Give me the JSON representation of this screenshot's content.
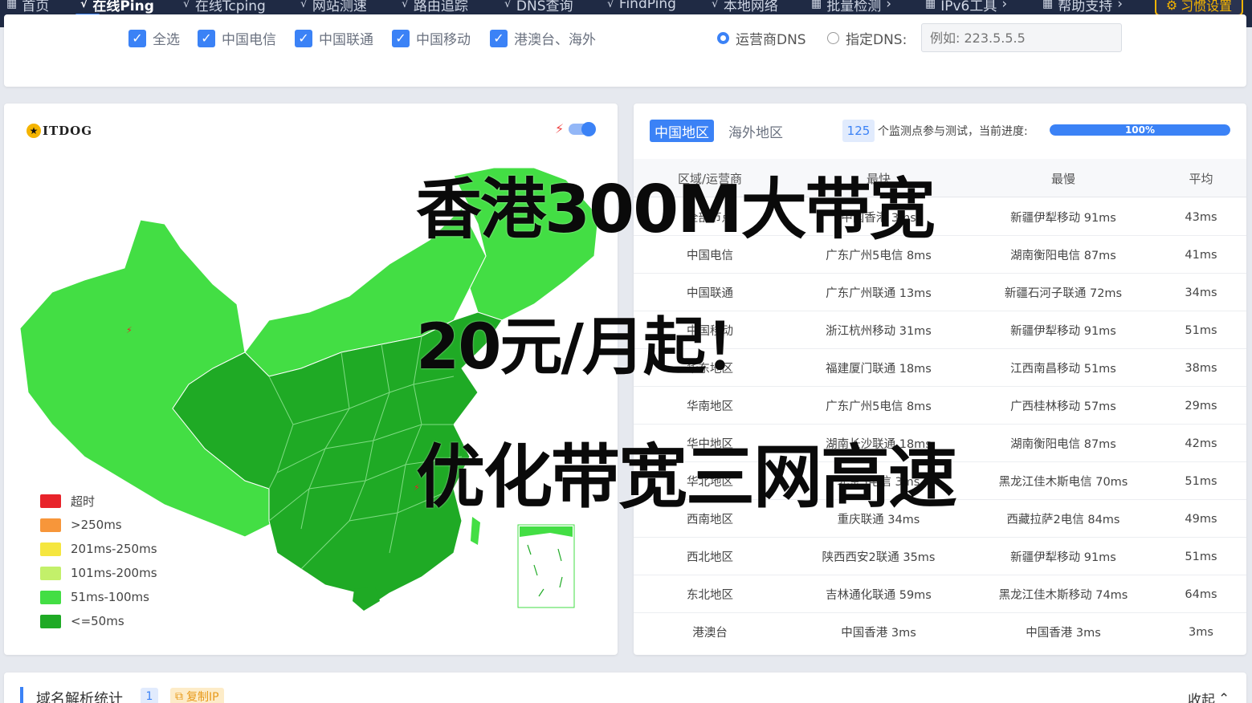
{
  "nav": {
    "items": [
      {
        "label": "首页",
        "icon": "grid-icon"
      },
      {
        "label": "在线Ping",
        "icon": "pulse-icon",
        "active": true
      },
      {
        "label": "在线Tcping",
        "icon": "pulse-icon"
      },
      {
        "label": "网站测速",
        "icon": "pulse-icon"
      },
      {
        "label": "路由追踪",
        "icon": "pulse-icon"
      },
      {
        "label": "DNS查询",
        "icon": "pulse-icon"
      },
      {
        "label": "FindPing",
        "icon": "pulse-icon"
      },
      {
        "label": "本地网络",
        "icon": "pulse-icon"
      },
      {
        "label": "批量检测",
        "icon": "grid-icon"
      },
      {
        "label": "IPv6工具",
        "icon": "grid-icon"
      },
      {
        "label": "帮助支持",
        "icon": "grid-icon"
      }
    ],
    "settings_label": "习惯设置"
  },
  "filters": {
    "checkboxes": [
      "全选",
      "中国电信",
      "中国联通",
      "中国移动",
      "港澳台、海外"
    ],
    "dns_options": [
      "运营商DNS",
      "指定DNS:"
    ],
    "dns_placeholder": "例如: 223.5.5.5"
  },
  "map": {
    "logo_text": "ITDOG",
    "legend": [
      {
        "label": "超时",
        "color": "#e8232a"
      },
      {
        "label": ">250ms",
        "color": "#f7963a"
      },
      {
        "label": "201ms-250ms",
        "color": "#f5e63f"
      },
      {
        "label": "101ms-200ms",
        "color": "#c3f06a"
      },
      {
        "label": "51ms-100ms",
        "color": "#43de44"
      },
      {
        "label": "<=50ms",
        "color": "#1faa25"
      }
    ]
  },
  "results": {
    "tabs": [
      "中国地区",
      "海外地区"
    ],
    "node_count": "125",
    "progress_label": "个监测点参与测试，当前进度:",
    "progress_value": "100%",
    "progress_fraction": 1.0,
    "headers": [
      "区域/运营商",
      "最快",
      "最慢",
      "平均"
    ],
    "rows": [
      [
        "全部节点",
        "中国香港 3ms",
        "新疆伊犁移动 91ms",
        "43ms"
      ],
      [
        "中国电信",
        "广东广州5电信 8ms",
        "湖南衡阳电信 87ms",
        "41ms"
      ],
      [
        "中国联通",
        "广东广州联通 13ms",
        "新疆石河子联通 72ms",
        "34ms"
      ],
      [
        "中国移动",
        "浙江杭州移动 31ms",
        "新疆伊犁移动 91ms",
        "51ms"
      ],
      [
        "华东地区",
        "福建厦门联通 18ms",
        "江西南昌移动 51ms",
        "38ms"
      ],
      [
        "华南地区",
        "广东广州5电信 8ms",
        "广西桂林移动 57ms",
        "29ms"
      ],
      [
        "华中地区",
        "湖南长沙联通 18ms",
        "湖南衡阳电信 87ms",
        "42ms"
      ],
      [
        "华北地区",
        "北京5电信 3ms",
        "黑龙江佳木斯电信 70ms",
        "51ms"
      ],
      [
        "西南地区",
        "重庆联通 34ms",
        "西藏拉萨2电信 84ms",
        "49ms"
      ],
      [
        "西北地区",
        "陕西西安2联通 35ms",
        "新疆伊犁移动 91ms",
        "51ms"
      ],
      [
        "东北地区",
        "吉林通化联通 59ms",
        "黑龙江佳木斯移动 74ms",
        "64ms"
      ],
      [
        "港澳台",
        "中国香港 3ms",
        "中国香港 3ms",
        "3ms"
      ]
    ]
  },
  "dns_stats": {
    "title": "域名解析统计",
    "count": "1",
    "copy_label": "复制IP",
    "collapse_label": "收起"
  },
  "overlay": {
    "line1": "香港300M大带宽",
    "line2": "20元/月起！",
    "line3": "优化带宽三网高速"
  }
}
